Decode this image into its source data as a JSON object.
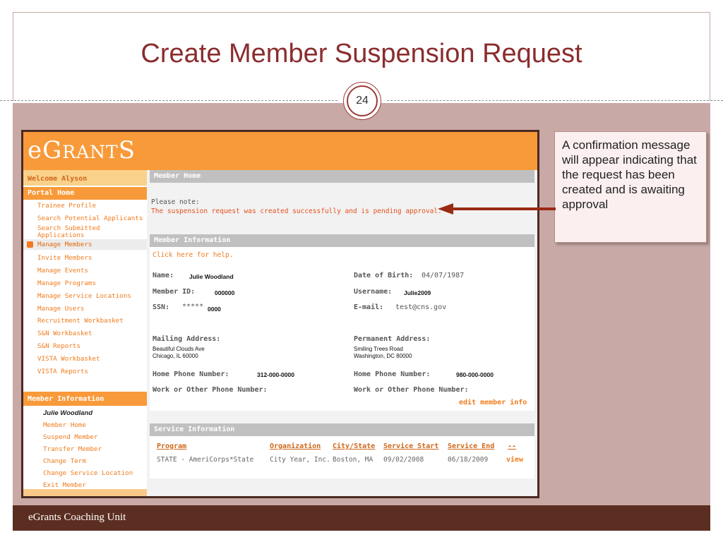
{
  "slide": {
    "title": "Create Member Suspension Request",
    "page_number": "24",
    "footer": "eGrants Coaching Unit",
    "callout": "A confirmation message will appear indicating that the request has been created and is awaiting approval"
  },
  "app": {
    "logo_big_e": "e",
    "logo_g": "G",
    "logo_rant": "RANT",
    "logo_s": "S",
    "sidebar": {
      "welcome": "Welcome Alyson",
      "portal_home": "Portal Home",
      "items": [
        "Trainee Profile",
        "Search Potential Applicants",
        "Search Submitted Applications",
        "Manage Members",
        "Invite Members",
        "Manage Events",
        "Manage Programs",
        "Manage Service Locations",
        "Manage Users",
        "Recruitment Workbasket",
        "S&N Workbasket",
        "S&N Reports",
        "VISTA Workbasket",
        "VISTA Reports"
      ],
      "member_info_head": "Member Information",
      "member_name": "Julie Woodland",
      "member_items": [
        "Member Home",
        "Suspend Member",
        "Transfer Member",
        "Change Term",
        "Change Service Location",
        "Exit Member"
      ]
    },
    "main": {
      "member_home_head": "Member Home",
      "note_label": "Please note:",
      "note_message": "The suspension request was created successfully and is pending approval.",
      "member_info_head": "Member Information",
      "help_link": "Click here for help.",
      "fields": {
        "name_label": "Name:",
        "name_value": "Julie Woodland",
        "dob_label": "Date of Birth:",
        "dob_value": "04/07/1987",
        "member_id_label": "Member ID:",
        "member_id_value": "000000",
        "username_label": "Username:",
        "username_value": "Julie2009",
        "ssn_label": "SSN:",
        "ssn_value_mask": "*****",
        "ssn_value_tail": "0000",
        "email_label": "E-mail:",
        "email_value": "test@cns.gov",
        "mailing_label": "Mailing Address:",
        "mailing_line1": "Beautiful Clouds Ave",
        "mailing_line2": "Chicago, IL 60000",
        "permanent_label": "Permanent Address:",
        "permanent_line1": "Smiling Trees Road",
        "permanent_line2": "Washington, DC 80000",
        "home_phone_label": "Home Phone Number:",
        "home_phone_value": "312-000-0000",
        "perm_home_phone_label": "Home Phone Number:",
        "perm_home_phone_value": "980-000-0000",
        "work_phone_label": "Work or Other Phone Number:",
        "perm_work_phone_label": "Work or Other Phone Number:"
      },
      "edit_link": "edit member info",
      "service_head": "Service Information",
      "table": {
        "headers": [
          "Program",
          "Organization",
          "City/State",
          "Service Start",
          "Service End",
          "--"
        ],
        "row": [
          "STATE - AmeriCorps*State",
          "City Year, Inc.",
          "Boston, MA",
          "09/02/2008",
          "06/18/2009",
          "view"
        ]
      }
    }
  },
  "colors": {
    "title": "#8b2d2e",
    "slide_bg": "#c9a9a6",
    "footer_bg": "#5b2e21",
    "banner": "#f89a3a",
    "link": "#f07c1e",
    "confirm_text": "#e4521f",
    "arrow": "#9a2a12"
  }
}
